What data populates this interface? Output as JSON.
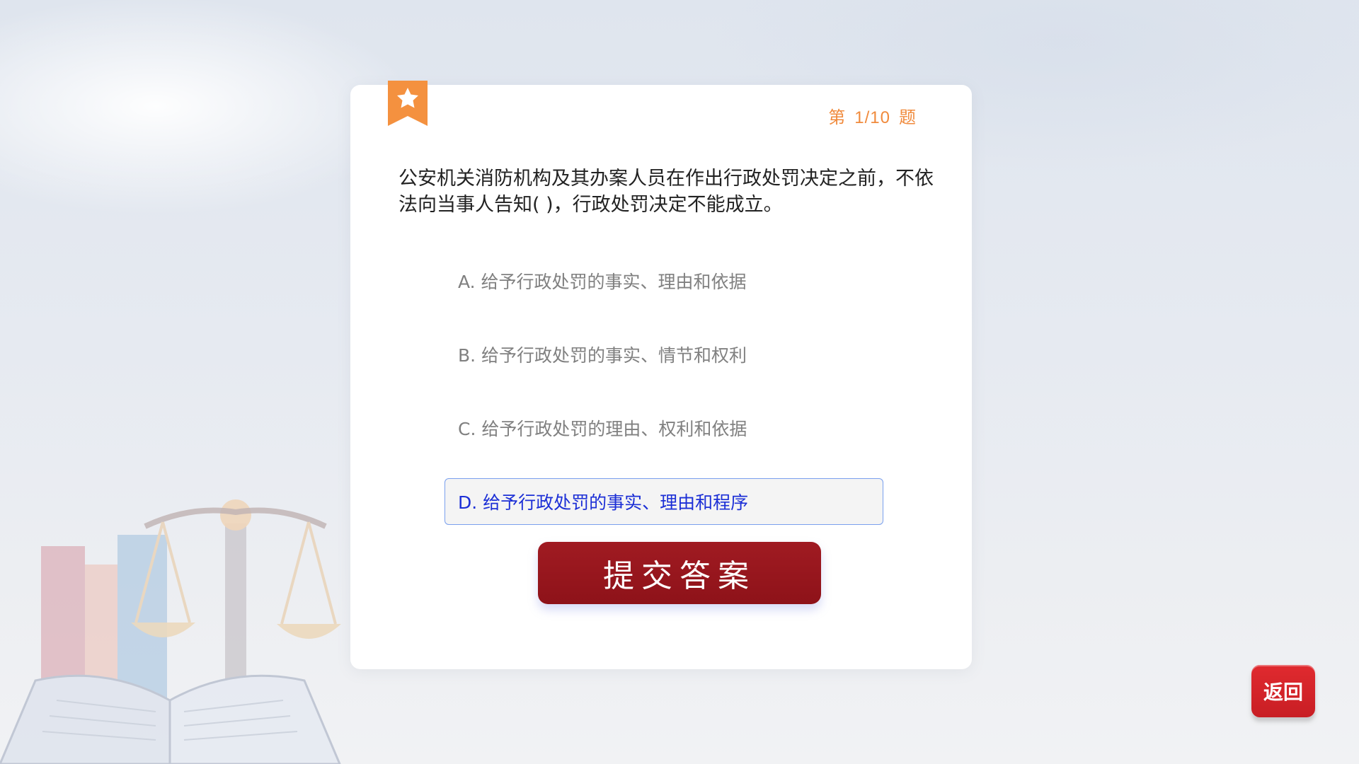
{
  "quiz": {
    "counter_prefix": "第",
    "counter_value": "1/10",
    "counter_suffix": "题",
    "question": "公安机关消防机构及其办案人员在作出行政处罚决定之前，不依法向当事人告知( )，行政处罚决定不能成立。",
    "options": [
      {
        "label": "A. 给予行政处罚的事实、理由和依据",
        "selected": false
      },
      {
        "label": "B. 给予行政处罚的事实、情节和权利",
        "selected": false
      },
      {
        "label": "C. 给予行政处罚的理由、权利和依据",
        "selected": false
      },
      {
        "label": "D. 给予行政处罚的事实、理由和程序",
        "selected": true
      }
    ],
    "submit_label": "提交答案"
  },
  "nav": {
    "back_label": "返回"
  },
  "icons": {
    "bookmark": "star-bookmark-icon"
  },
  "colors": {
    "accent_orange": "#f08a3c",
    "submit_red": "#921219",
    "selected_blue": "#1c2fd6",
    "back_red": "#d8242a"
  }
}
